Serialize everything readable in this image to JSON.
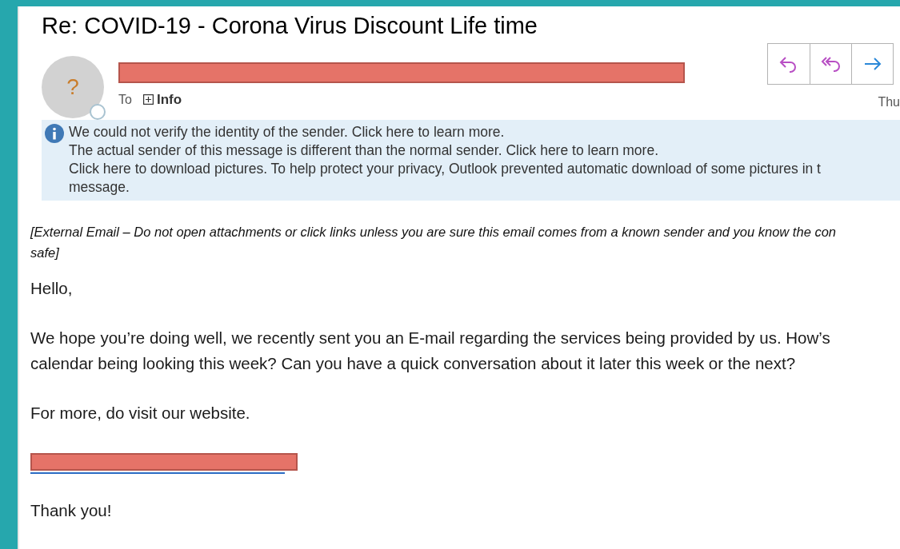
{
  "subject": "Re: COVID-19 - Corona Virus Discount Life time",
  "avatar": {
    "glyph": "?"
  },
  "to_label": "To",
  "recipient": "Info",
  "date": "Thu",
  "actions": [
    {
      "kind": "reply"
    },
    {
      "kind": "reply_all"
    },
    {
      "kind": "forward"
    }
  ],
  "info_bar": [
    "We could not verify the identity of the sender. Click here to learn more.",
    "The actual sender of this message is different than the normal sender. Click here to learn more.",
    "Click here to download pictures. To help protect your privacy, Outlook prevented automatic download of some pictures in t",
    "message."
  ],
  "caution": [
    "[External Email – Do not open attachments or click links unless you are sure this email comes from a known sender and you know the con",
    "safe]"
  ],
  "body": [
    {
      "kind": "text",
      "lines": [
        "Hello,"
      ]
    },
    {
      "kind": "text",
      "lines": [
        "We hope you’re doing well, we recently sent you an E-mail regarding the services being provided by us. How’s",
        "calendar being looking this week? Can you have a quick conversation about it later this week or the next?"
      ]
    },
    {
      "kind": "text",
      "lines": [
        "For more, do visit our website."
      ]
    },
    {
      "kind": "redacted_link"
    },
    {
      "kind": "text",
      "lines": [
        "Thank you!"
      ]
    }
  ]
}
